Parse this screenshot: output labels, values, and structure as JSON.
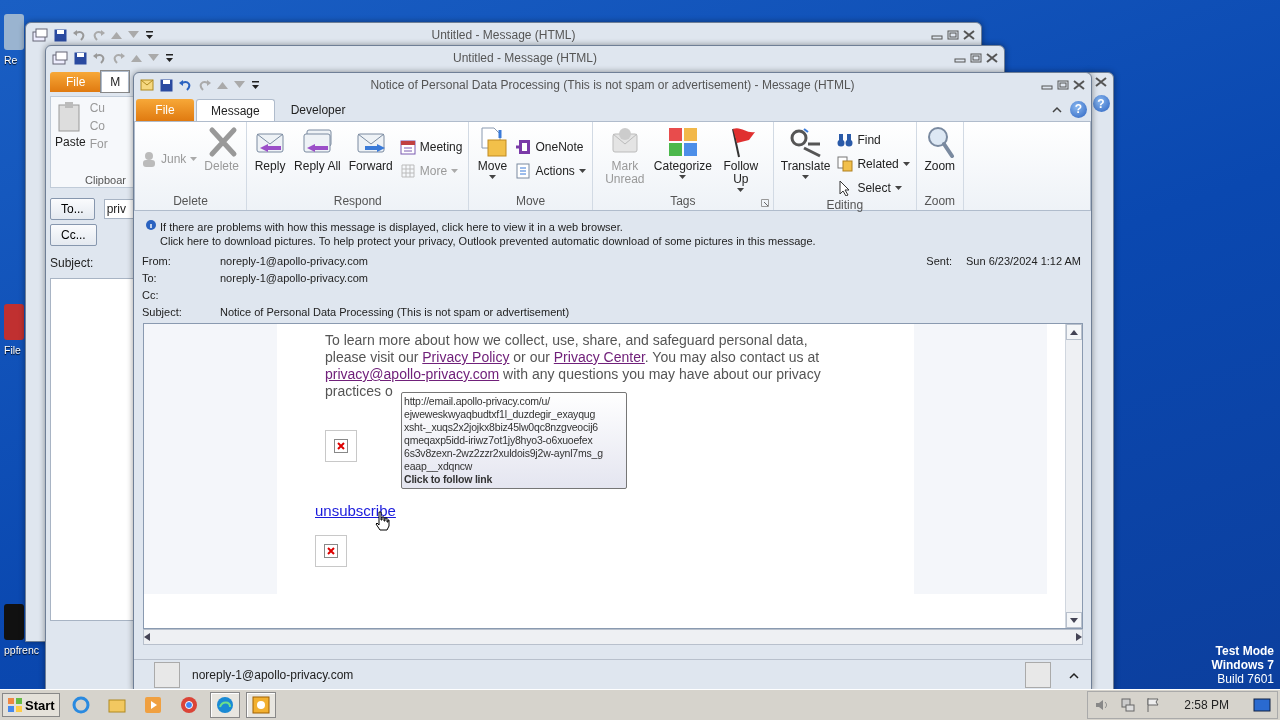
{
  "desktop": {
    "icons": [
      {
        "label": "Re"
      },
      {
        "label": "File"
      },
      {
        "label": "ppfrenc"
      }
    ],
    "os_notice": [
      "Test Mode",
      "Windows 7",
      "Build 7601"
    ]
  },
  "back_windows": [
    {
      "title": "Untitled - Message (HTML)"
    },
    {
      "title": "Untitled - Message (HTML)",
      "tabs": [
        {
          "label": "File",
          "selected": false
        },
        {
          "label": "M",
          "selected": true
        }
      ],
      "paste_label": "Paste",
      "clipboard_items": [
        "Cu",
        "Co",
        "For"
      ],
      "group_label": "Clipboar",
      "to_button": "To...",
      "to_value": "priv",
      "cc_button": "Cc...",
      "subject_label": "Subject:"
    }
  ],
  "side_window": {
    "help": "?"
  },
  "window": {
    "title": "Notice of Personal Data Processing (This is not spam or advertisement) - Message (HTML)"
  },
  "tabs": [
    {
      "label": "File",
      "kind": "file",
      "selected": false
    },
    {
      "label": "Message",
      "kind": "tab",
      "selected": true
    },
    {
      "label": "Developer",
      "kind": "tab",
      "selected": false
    }
  ],
  "help": "?",
  "ribbon": {
    "groups": [
      {
        "label": "Delete",
        "buttons": [
          {
            "label": "Junk",
            "kind": "small",
            "disabled": true,
            "dropdown": true
          },
          {
            "label": "Delete",
            "kind": "large",
            "disabled": true,
            "dropdown": false
          }
        ]
      },
      {
        "label": "Respond",
        "buttons": [
          {
            "label": "Reply",
            "kind": "large",
            "disabled": false,
            "dropdown": false
          },
          {
            "label": "Reply All",
            "kind": "large",
            "disabled": false,
            "dropdown": false
          },
          {
            "label": "Forward",
            "kind": "large",
            "disabled": false,
            "dropdown": false
          },
          {
            "label": "Meeting",
            "kind": "small",
            "disabled": false,
            "dropdown": false
          },
          {
            "label": "More",
            "kind": "small",
            "disabled": true,
            "dropdown": true
          }
        ]
      },
      {
        "label": "Move",
        "buttons": [
          {
            "label": "Move",
            "kind": "large",
            "disabled": false,
            "dropdown": true
          },
          {
            "label": "OneNote",
            "kind": "small",
            "disabled": false,
            "dropdown": false
          },
          {
            "label": "Actions",
            "kind": "small",
            "disabled": false,
            "dropdown": true
          }
        ]
      },
      {
        "label": "Tags",
        "launcher": true,
        "buttons": [
          {
            "label": "Mark Unread",
            "kind": "large",
            "disabled": true,
            "dropdown": false
          },
          {
            "label": "Categorize",
            "kind": "large",
            "disabled": false,
            "dropdown": true
          },
          {
            "label": "Follow Up",
            "kind": "large",
            "disabled": false,
            "dropdown": true
          }
        ]
      },
      {
        "label": "Editing",
        "buttons": [
          {
            "label": "Translate",
            "kind": "large",
            "disabled": false,
            "dropdown": true
          },
          {
            "label": "Find",
            "kind": "small",
            "disabled": false,
            "dropdown": false
          },
          {
            "label": "Related",
            "kind": "small",
            "disabled": false,
            "dropdown": true
          },
          {
            "label": "Select",
            "kind": "small",
            "disabled": false,
            "dropdown": true
          }
        ]
      },
      {
        "label": "Zoom",
        "buttons": [
          {
            "label": "Zoom",
            "kind": "large",
            "disabled": false,
            "dropdown": false
          }
        ]
      }
    ]
  },
  "infobar": [
    "If there are problems with how this message is displayed, click here to view it in a web browser.",
    "Click here to download pictures. To help protect your privacy, Outlook prevented automatic download of some pictures in this message."
  ],
  "header": {
    "fields": [
      {
        "label": "From:",
        "value": "noreply-1@apollo-privacy.com"
      },
      {
        "label": "To:",
        "value": "noreply-1@apollo-privacy.com"
      },
      {
        "label": "Cc:"
      },
      {
        "label": "Subject:",
        "value": "Notice of Personal Data Processing (This is not spam or advertisement)"
      }
    ],
    "sent": {
      "label": "Sent:",
      "value": "Sun 6/23/2024 1:12 AM"
    }
  },
  "body": {
    "paragraph": [
      {
        "text": "To learn more about how we collect, use, share, and safeguard personal data, please visit our "
      },
      {
        "link": "Privacy Policy"
      },
      {
        "text": " or our "
      },
      {
        "link": "Privacy Center"
      },
      {
        "text": ". You may also contact us at "
      },
      {
        "link": "privacy@apollo-privacy.com"
      },
      {
        "text": " with any questions you may have about our privacy practices o"
      }
    ],
    "unsubscribe": "unsubscribe",
    "tooltip": {
      "lines": [
        "http://email.apollo-privacy.com/u/",
        "ejweweskwyaqbudtxf1l_duzdegir_exayqug",
        "xsht-_xuqs2x2jojkx8biz45lw0qc8nzgveocij6",
        "qmeqaxp5idd-iriwz7ot1jy8hyo3-o6xuoefex",
        "6s3v8zexn-2wz2zzr2xuldois9j2w-aynl7ms_g",
        "eaap__xdqncw"
      ],
      "action": "Click to follow link"
    }
  },
  "people_pane": {
    "contact": "noreply-1@apollo-privacy.com"
  },
  "taskbar": {
    "start": "Start",
    "apps": [
      {
        "running": false
      },
      {
        "running": false
      },
      {
        "running": false
      },
      {
        "running": false
      },
      {
        "running": true
      },
      {
        "running": true
      }
    ],
    "time": "2:58 PM"
  }
}
